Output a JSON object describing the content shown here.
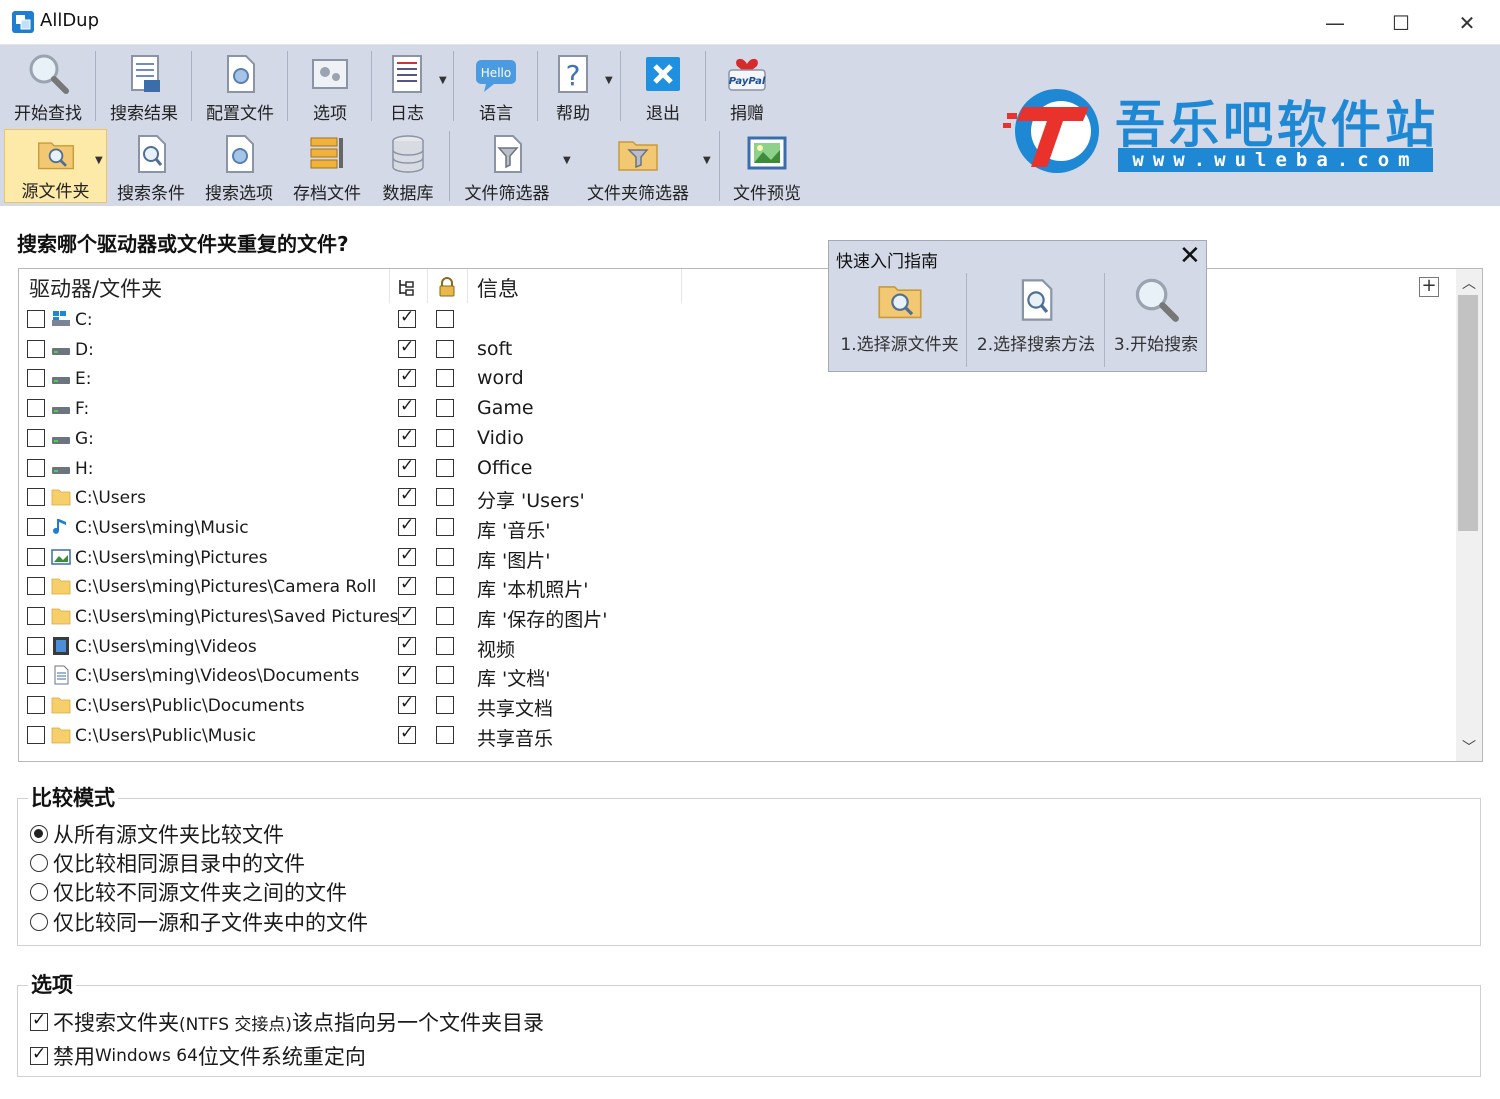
{
  "window": {
    "title": "AllDup"
  },
  "toolbar1": [
    {
      "label": "开始查找",
      "icon": "magnifier-icon"
    },
    {
      "label": "搜索结果",
      "icon": "search-results-icon"
    },
    {
      "label": "配置文件",
      "icon": "config-file-icon"
    },
    {
      "label": "选项",
      "icon": "options-icon"
    },
    {
      "label": "日志",
      "icon": "log-icon"
    },
    {
      "label": "语言",
      "icon": "language-hello-icon",
      "icon_text": "Hello"
    },
    {
      "label": "帮助",
      "icon": "help-icon",
      "icon_text": "?"
    },
    {
      "label": "退出",
      "icon": "exit-icon"
    },
    {
      "label": "捐赠",
      "icon": "paypal-donate-icon",
      "icon_text": "PayPal"
    }
  ],
  "toolbar2": [
    {
      "label": "源文件夹",
      "icon": "source-folder-icon",
      "active": true
    },
    {
      "label": "搜索条件",
      "icon": "search-criteria-icon"
    },
    {
      "label": "搜索选项",
      "icon": "search-options-icon"
    },
    {
      "label": "存档文件",
      "icon": "archive-file-icon"
    },
    {
      "label": "数据库",
      "icon": "database-icon"
    },
    {
      "label": "文件筛选器",
      "icon": "file-filter-icon"
    },
    {
      "label": "文件夹筛选器",
      "icon": "folder-filter-icon"
    },
    {
      "label": "文件预览",
      "icon": "file-preview-icon"
    }
  ],
  "watermark": {
    "main": "吾乐吧软件站",
    "sub": "www.wuleba.com"
  },
  "main": {
    "question": "搜索哪个驱动器或文件夹重复的文件?"
  },
  "list": {
    "columns": {
      "path": "驱动器/文件夹",
      "info": "信息"
    },
    "rows": [
      {
        "path": "C:",
        "info": "",
        "icon": "windows-drive-icon",
        "selected": false,
        "subfolders": true,
        "locked": false
      },
      {
        "path": "D:",
        "info": "soft",
        "icon": "drive-icon",
        "selected": false,
        "subfolders": true,
        "locked": false
      },
      {
        "path": "E:",
        "info": "word",
        "icon": "drive-icon",
        "selected": false,
        "subfolders": true,
        "locked": false
      },
      {
        "path": "F:",
        "info": "Game",
        "icon": "drive-icon",
        "selected": false,
        "subfolders": true,
        "locked": false
      },
      {
        "path": "G:",
        "info": "Vidio",
        "icon": "drive-icon",
        "selected": false,
        "subfolders": true,
        "locked": false
      },
      {
        "path": "H:",
        "info": "Office",
        "icon": "drive-icon",
        "selected": false,
        "subfolders": true,
        "locked": false
      },
      {
        "path": "C:\\Users",
        "info": "分享 'Users'",
        "icon": "folder-icon",
        "selected": false,
        "subfolders": true,
        "locked": false
      },
      {
        "path": "C:\\Users\\ming\\Music",
        "info": "库 '音乐'",
        "icon": "music-note-icon",
        "selected": false,
        "subfolders": true,
        "locked": false
      },
      {
        "path": "C:\\Users\\ming\\Pictures",
        "info": "库 '图片'",
        "icon": "pictures-icon",
        "selected": false,
        "subfolders": true,
        "locked": false
      },
      {
        "path": "C:\\Users\\ming\\Pictures\\Camera Roll",
        "info": "库 '本机照片'",
        "icon": "folder-icon",
        "selected": false,
        "subfolders": true,
        "locked": false
      },
      {
        "path": "C:\\Users\\ming\\Pictures\\Saved Pictures",
        "info": "库 '保存的图片'",
        "icon": "folder-icon",
        "selected": false,
        "subfolders": true,
        "locked": false
      },
      {
        "path": "C:\\Users\\ming\\Videos",
        "info": "视频",
        "icon": "film-icon",
        "selected": false,
        "subfolders": true,
        "locked": false
      },
      {
        "path": "C:\\Users\\ming\\Videos\\Documents",
        "info": "库 '文档'",
        "icon": "document-icon",
        "selected": false,
        "subfolders": true,
        "locked": false
      },
      {
        "path": "C:\\Users\\Public\\Documents",
        "info": "共享文档",
        "icon": "folder-icon",
        "selected": false,
        "subfolders": true,
        "locked": false
      },
      {
        "path": "C:\\Users\\Public\\Music",
        "info": "共享音乐",
        "icon": "folder-icon",
        "selected": false,
        "subfolders": true,
        "locked": false
      }
    ]
  },
  "guide": {
    "title": "快速入门指南",
    "steps": [
      {
        "label": "1.选择源文件夹",
        "icon": "source-folder-icon"
      },
      {
        "label": "2.选择搜索方法",
        "icon": "search-method-icon"
      },
      {
        "label": "3.开始搜索",
        "icon": "magnifier-icon"
      }
    ]
  },
  "compare": {
    "title": "比较模式",
    "options": [
      {
        "label": "从所有源文件夹比较文件",
        "checked": true
      },
      {
        "label": "仅比较相同源目录中的文件",
        "checked": false
      },
      {
        "label": "仅比较不同源文件夹之间的文件",
        "checked": false
      },
      {
        "label": "仅比较同一源和子文件夹中的文件",
        "checked": false
      }
    ]
  },
  "options": {
    "title": "选项",
    "items": [
      {
        "pre": "不搜索文件夹 ",
        "small": "(NTFS 交接点)",
        "post": " 该点指向另一个文件夹目录",
        "checked": true
      },
      {
        "pre": "禁用 ",
        "small": "Windows 64",
        "post": " 位文件系统重定向",
        "checked": true
      }
    ]
  },
  "colors": {
    "toolbar_bg": "#d4d9e8",
    "active_bg": "#fde9a8",
    "logo_blue": "#1e88d4",
    "logo_red": "#e8322b"
  }
}
